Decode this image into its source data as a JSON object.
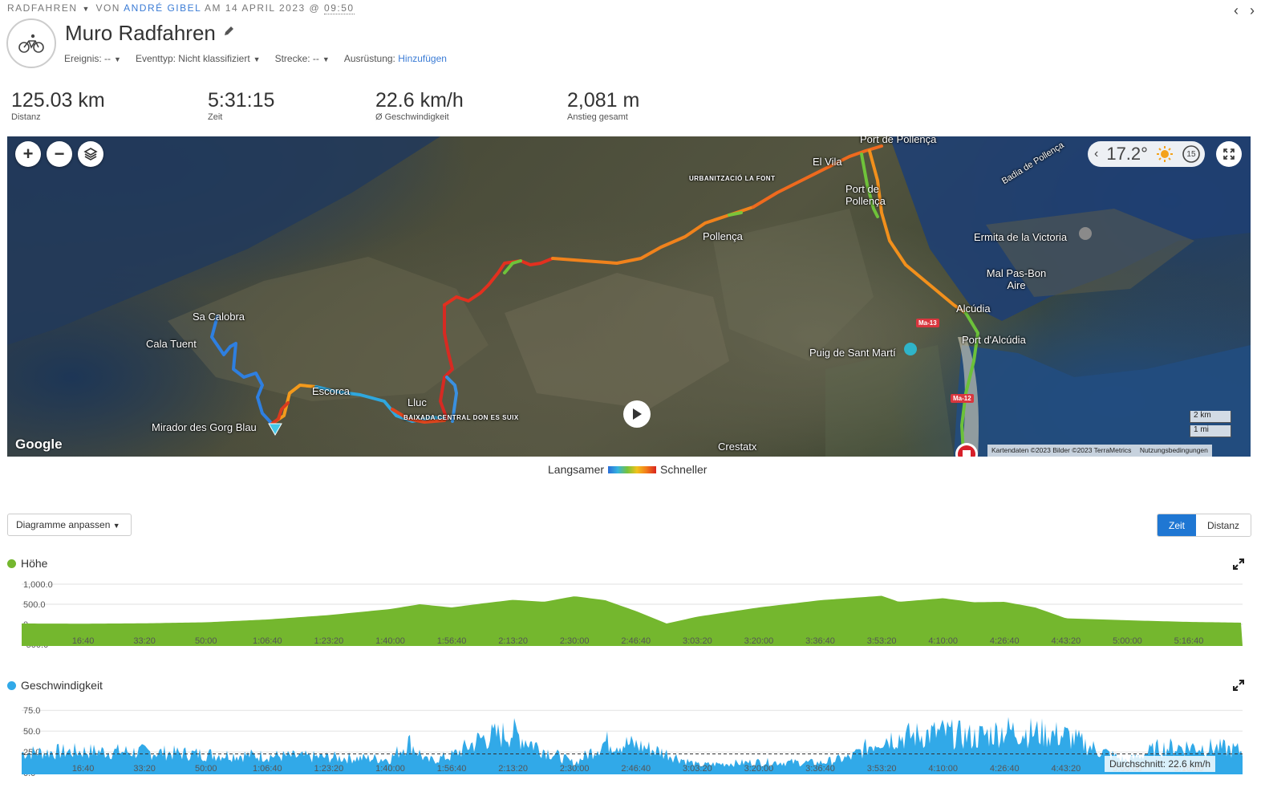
{
  "header": {
    "activity_type": "RADFAHREN",
    "by_prefix": "VON",
    "author": "ANDRÉ GIBEL",
    "date_prefix": "AM 14 APRIL 2023 @",
    "time": "09:50",
    "title": "Muro Radfahren",
    "icons": {
      "activity": "bicycle-icon",
      "edit": "pencil-icon",
      "prev": "chevron-left-icon",
      "next": "chevron-right-icon"
    }
  },
  "meta": {
    "event_label": "Ereignis: --",
    "event_type_label": "Eventtyp: Nicht klassifiziert",
    "course_label": "Strecke: --",
    "gear_label": "Ausrüstung:",
    "gear_link": "Hinzufügen"
  },
  "stats": [
    {
      "value": "125.03 km",
      "label": "Distanz"
    },
    {
      "value": "5:31:15",
      "label": "Zeit"
    },
    {
      "value": "22.6 km/h",
      "label": "Ø Geschwindigkeit"
    },
    {
      "value": "2,081 m",
      "label": "Anstieg gesamt"
    }
  ],
  "map": {
    "zoom_in": "+",
    "zoom_out": "−",
    "temperature": "17.2°",
    "weather_icon": "sun-icon",
    "replay_label": "15",
    "labels": {
      "port_pollenca_top": "Port de Pollença",
      "el_vila": "El Vila",
      "port_pollenca": "Port de Pollença",
      "badia": "Badia de Pollença",
      "urbanitzacio": "URBANITZACIÓ LA FONT",
      "pollenca": "Pollença",
      "ermita": "Ermita de la Victoria",
      "malpas": "Mal Pas-Bon Aire",
      "alcudia": "Alcúdia",
      "port_alcudia": "Port d'Alcúdia",
      "puig": "Puig de Sant Martí",
      "sa_calobra": "Sa Calobra",
      "cala_tuent": "Cala Tuent",
      "mirador": "Mirador des Gorg Blau",
      "lluc": "Lluc",
      "escorca": "Escorca",
      "baixa": "BAIXADA CENTRAL DON ES SUIX",
      "crestatx": "Crestatx"
    },
    "road_ma13": "Ma-13",
    "road_ma12": "Ma-12",
    "google": "Google",
    "scale_km": "2 km",
    "scale_mi": "1 mi",
    "copyright": "Kartendaten ©2023 Bilder ©2023 TerraMetrics",
    "terms": "Nutzungsbedingungen"
  },
  "legend": {
    "slower": "Langsamer",
    "faster": "Schneller"
  },
  "controls": {
    "customize": "Diagramme anpassen",
    "time_toggle": "Zeit",
    "distance_toggle": "Distanz"
  },
  "x_ticks": [
    "16:40",
    "33:20",
    "50:00",
    "1:06:40",
    "1:23:20",
    "1:40:00",
    "1:56:40",
    "2:13:20",
    "2:30:00",
    "2:46:40",
    "3:03:20",
    "3:20:00",
    "3:36:40",
    "3:53:20",
    "4:10:00",
    "4:26:40",
    "4:43:20",
    "5:00:00",
    "5:16:40"
  ],
  "elevation_chart": {
    "title": "Höhe",
    "color": "#74b72e",
    "y_ticks": [
      "1,000.0",
      "500.0",
      "0",
      "-500.0"
    ]
  },
  "speed_chart": {
    "title": "Geschwindigkeit",
    "color": "#31a9e8",
    "y_ticks": [
      "75.0",
      "50.0",
      "25.0",
      "0.0"
    ],
    "average_label": "Durchschnitt: 22.6 km/h"
  },
  "chart_data": [
    {
      "type": "area",
      "title": "Höhe",
      "xlabel": "",
      "ylabel": "",
      "ylim": [
        -500,
        1000
      ],
      "x": [
        "0:00",
        "16:40",
        "33:20",
        "50:00",
        "1:06:40",
        "1:23:20",
        "1:40:00",
        "1:48:00",
        "1:56:40",
        "2:05:00",
        "2:13:20",
        "2:21:40",
        "2:30:00",
        "2:38:20",
        "2:46:40",
        "2:55:00",
        "3:03:20",
        "3:20:00",
        "3:36:40",
        "3:53:20",
        "3:58:00",
        "4:10:00",
        "4:18:20",
        "4:26:40",
        "4:35:00",
        "4:43:20",
        "5:00:00",
        "5:16:40",
        "5:31:15"
      ],
      "series": [
        {
          "values": [
            20,
            15,
            25,
            50,
            120,
            230,
            380,
            500,
            420,
            520,
            610,
            560,
            700,
            600,
            330,
            20,
            190,
            420,
            600,
            710,
            560,
            650,
            550,
            560,
            420,
            150,
            100,
            60,
            40
          ]
        }
      ]
    },
    {
      "type": "area",
      "title": "Geschwindigkeit",
      "xlabel": "",
      "ylabel": "",
      "ylim": [
        0,
        80
      ],
      "x": [
        "0:00",
        "16:40",
        "33:20",
        "50:00",
        "1:06:40",
        "1:23:20",
        "1:40:00",
        "1:45:00",
        "1:50:00",
        "1:56:40",
        "2:05:00",
        "2:13:20",
        "2:21:40",
        "2:30:00",
        "2:38:20",
        "2:46:40",
        "2:55:00",
        "3:03:20",
        "3:20:00",
        "3:36:40",
        "3:45:00",
        "3:53:20",
        "4:01:40",
        "4:10:00",
        "4:18:20",
        "4:26:40",
        "4:35:00",
        "4:43:20",
        "4:51:40",
        "5:00:00",
        "5:08:20",
        "5:16:40",
        "5:25:00",
        "5:31:15"
      ],
      "series": [
        {
          "values": [
            26,
            28,
            27,
            24,
            22,
            20,
            18,
            40,
            15,
            22,
            45,
            52,
            30,
            12,
            40,
            36,
            25,
            10,
            14,
            13,
            20,
            45,
            48,
            52,
            46,
            55,
            52,
            48,
            30,
            15,
            32,
            34,
            32,
            28
          ]
        }
      ],
      "average": 22.6
    }
  ]
}
